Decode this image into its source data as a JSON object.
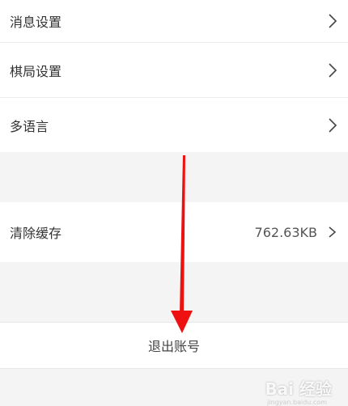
{
  "settings": {
    "items": [
      {
        "label": "消息设置"
      },
      {
        "label": "棋局设置"
      },
      {
        "label": "多语言"
      }
    ]
  },
  "storage": {
    "label": "清除缓存",
    "value": "762.63KB"
  },
  "logout": {
    "label": "退出账号"
  },
  "watermark": {
    "text": "Bai 经验",
    "sub": "jingyan.baidu.com"
  },
  "colors": {
    "arrow": "#ee1111",
    "background": "#f4f4f4"
  }
}
